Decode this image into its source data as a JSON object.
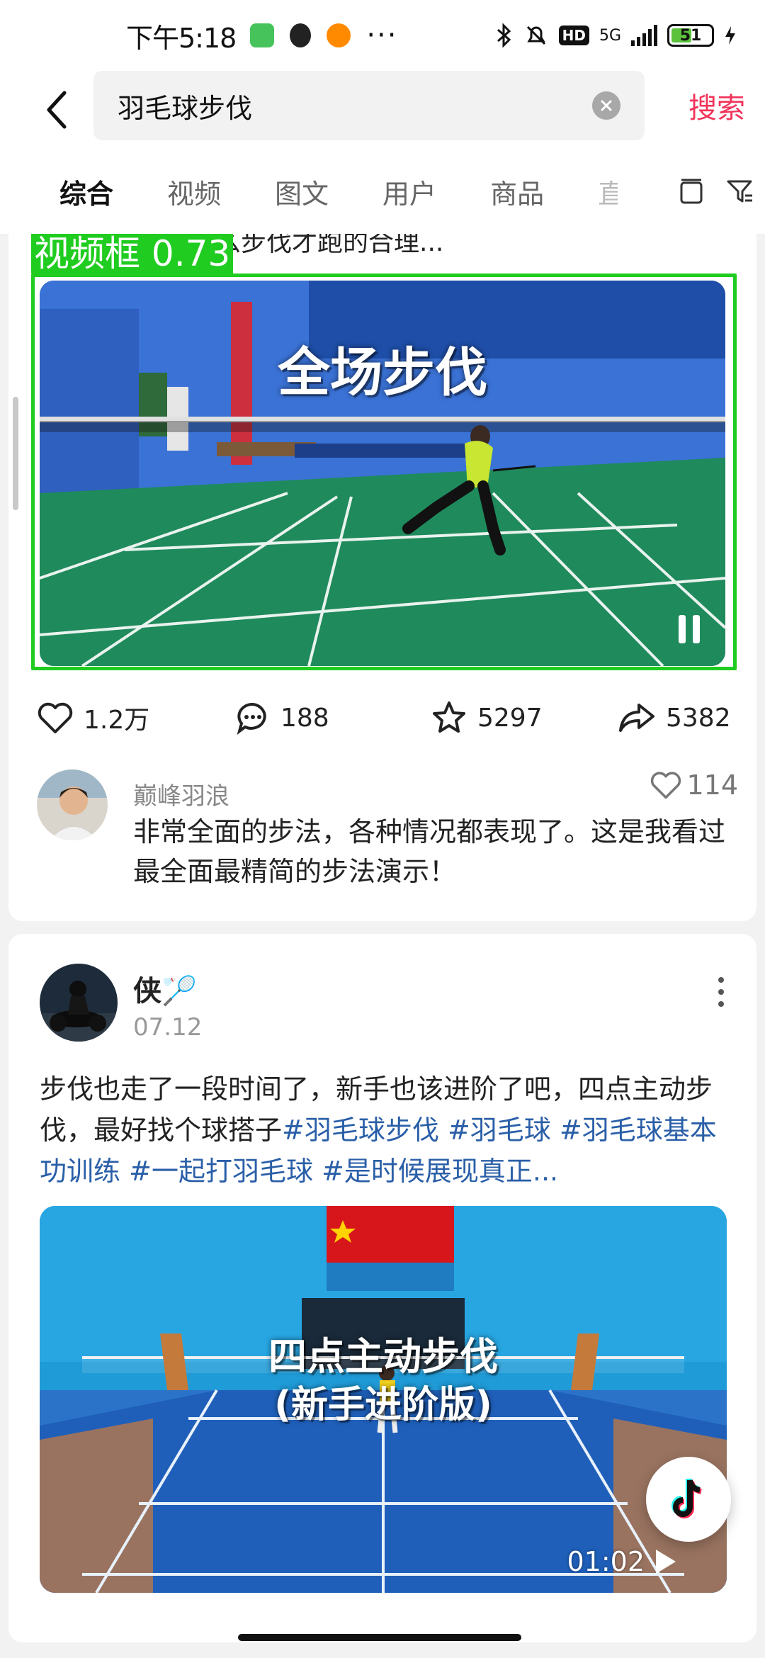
{
  "status_bar": {
    "time": "下午5:18",
    "apps": [
      "wechat-icon",
      "qq-icon",
      "58-app-icon"
    ],
    "more": "···",
    "network": "5G",
    "hd": "HD",
    "battery": "51",
    "battery_level": 0.51
  },
  "search": {
    "query": "羽毛球步伐",
    "submit_label": "搜索"
  },
  "tabs": [
    {
      "label": "综合",
      "active": true
    },
    {
      "label": "视频",
      "active": false
    },
    {
      "label": "图文",
      "active": false
    },
    {
      "label": "用户",
      "active": false
    },
    {
      "label": "商品",
      "active": false
    },
    {
      "label": "直",
      "active": false
    }
  ],
  "card1": {
    "title_line": "打什么球该用什么步伐才跑的合理...",
    "detection_label": "视频框 0.73",
    "video_overlay_text": "全场步伐",
    "actions": {
      "likes": "1.2万",
      "comments": "188",
      "favorites": "5297",
      "shares": "5382"
    },
    "comment": {
      "user": "巅峰羽浪",
      "likes": "114",
      "text": "非常全面的步法，各种情况都表现了。这是我看过最全面最精简的步法演示！"
    }
  },
  "card2": {
    "author": "侠🏸",
    "date": "07.12",
    "text": "步伐也走了一段时间了，新手也该进阶了吧，四点主动步伐，最好找个球搭子",
    "hashtags": [
      "#羽毛球步伐",
      "#羽毛球",
      "#羽毛球基本功训练",
      "#一起打羽毛球",
      "#是时候展现真正..."
    ],
    "video_overlay_line1": "四点主动步伐",
    "video_overlay_line2": "(新手进阶版)",
    "duration": "01:02"
  },
  "colors": {
    "accent_red": "#f2345a",
    "hashtag_blue": "#2a5fa8",
    "detection_green": "#1fcc1f"
  }
}
